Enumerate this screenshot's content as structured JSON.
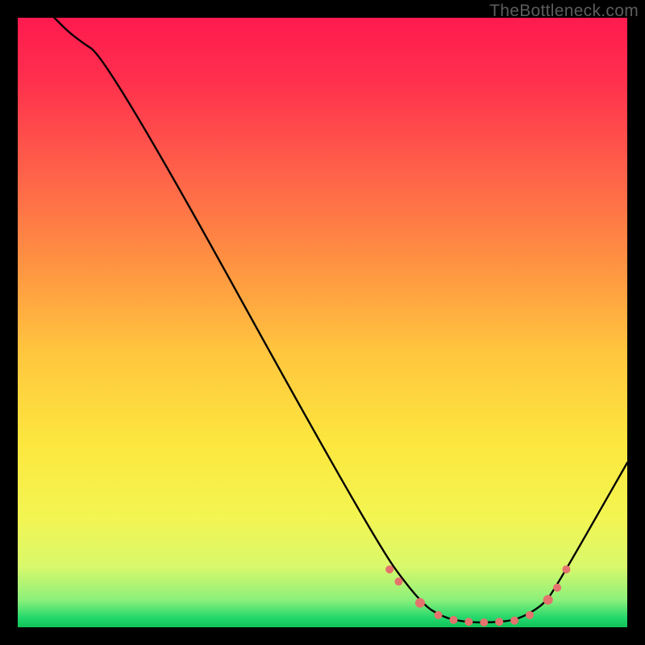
{
  "attribution": "TheBottleneck.com",
  "gradient": {
    "stops": [
      {
        "offset": 0.0,
        "color": "#ff1a4f"
      },
      {
        "offset": 0.1,
        "color": "#ff2f4d"
      },
      {
        "offset": 0.25,
        "color": "#ff604a"
      },
      {
        "offset": 0.4,
        "color": "#ff9142"
      },
      {
        "offset": 0.55,
        "color": "#ffc63e"
      },
      {
        "offset": 0.7,
        "color": "#fce73e"
      },
      {
        "offset": 0.82,
        "color": "#f3f552"
      },
      {
        "offset": 0.9,
        "color": "#d9f86b"
      },
      {
        "offset": 0.955,
        "color": "#8cf07a"
      },
      {
        "offset": 0.985,
        "color": "#22d76b"
      },
      {
        "offset": 1.0,
        "color": "#10c35a"
      }
    ]
  },
  "chart_data": {
    "type": "line",
    "title": "",
    "xlabel": "",
    "ylabel": "",
    "xlim": [
      0,
      100
    ],
    "ylim": [
      0,
      100
    ],
    "series": [
      {
        "name": "bottleneck-curve",
        "x": [
          6,
          9,
          15,
          58,
          66,
          70,
          74,
          78,
          82,
          86,
          88,
          100
        ],
        "y": [
          100,
          97,
          93,
          15,
          4,
          1.5,
          0.8,
          0.8,
          1.2,
          3.5,
          6,
          27
        ]
      }
    ],
    "markers": {
      "name": "highlighted-points",
      "color": "#e5736d",
      "points": [
        {
          "x": 61.0,
          "y": 9.5,
          "r": 5
        },
        {
          "x": 62.5,
          "y": 7.5,
          "r": 5
        },
        {
          "x": 66.0,
          "y": 4.0,
          "r": 6
        },
        {
          "x": 69.0,
          "y": 2.0,
          "r": 5
        },
        {
          "x": 71.5,
          "y": 1.2,
          "r": 5
        },
        {
          "x": 74.0,
          "y": 0.9,
          "r": 5
        },
        {
          "x": 76.5,
          "y": 0.8,
          "r": 5
        },
        {
          "x": 79.0,
          "y": 0.9,
          "r": 5
        },
        {
          "x": 81.5,
          "y": 1.1,
          "r": 5
        },
        {
          "x": 84.0,
          "y": 2.0,
          "r": 5
        },
        {
          "x": 87.0,
          "y": 4.5,
          "r": 6
        },
        {
          "x": 88.5,
          "y": 6.5,
          "r": 5
        },
        {
          "x": 90.0,
          "y": 9.5,
          "r": 5
        }
      ]
    }
  }
}
